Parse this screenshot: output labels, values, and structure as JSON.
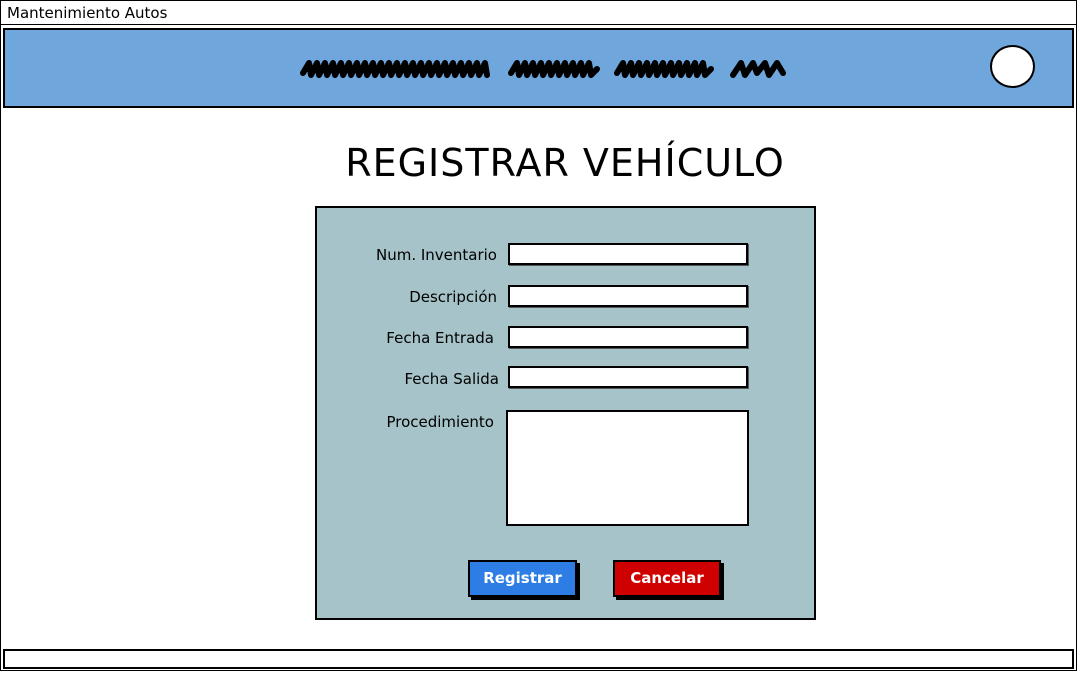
{
  "window": {
    "title": "Mantenimiento Autos"
  },
  "header": {
    "banner_icon": "scribble-banner",
    "avatar_icon": "circle-avatar",
    "background": "#6fa6dc"
  },
  "page": {
    "title": "REGISTRAR VEHÍCULO"
  },
  "form": {
    "background": "#a5c3c8",
    "fields": [
      {
        "label": "Num. Inventario",
        "value": ""
      },
      {
        "label": "Descripción",
        "value": ""
      },
      {
        "label": "Fecha Entrada",
        "value": ""
      },
      {
        "label": "Fecha Salida",
        "value": ""
      },
      {
        "label": "Procedimiento",
        "value": ""
      }
    ],
    "register_label": "Registrar",
    "cancel_label": "Cancelar",
    "register_color": "#2d7de4",
    "cancel_color": "#cf0000"
  }
}
